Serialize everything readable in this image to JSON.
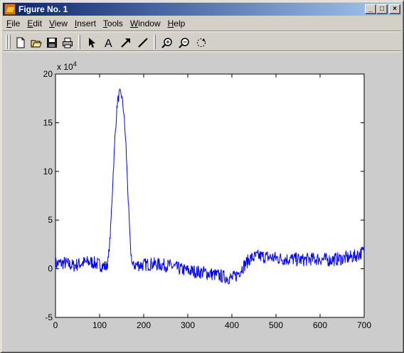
{
  "window": {
    "title": "Figure No. 1",
    "controls": {
      "minimize": "_",
      "maximize": "□",
      "close": "×"
    }
  },
  "menu": {
    "items": [
      {
        "key": "F",
        "rest": "ile"
      },
      {
        "key": "E",
        "rest": "dit"
      },
      {
        "key": "V",
        "rest": "iew"
      },
      {
        "key": "I",
        "rest": "nsert"
      },
      {
        "key": "T",
        "rest": "ools"
      },
      {
        "key": "W",
        "rest": "indow"
      },
      {
        "key": "H",
        "rest": "elp"
      }
    ]
  },
  "toolbar": {
    "icons": [
      "new-file-icon",
      "open-folder-icon",
      "save-icon",
      "print-icon",
      "select-arrow-icon",
      "text-icon",
      "arrow-icon",
      "line-icon",
      "zoom-in-icon",
      "zoom-out-icon",
      "rotate-icon"
    ],
    "text_tool_glyph": "A"
  },
  "colors": {
    "titlebar_start": "#0a246a",
    "titlebar_end": "#a6caf0",
    "figure_background": "#cccccc",
    "axes_background": "#ffffff",
    "line": "#0000ff"
  },
  "chart_data": {
    "type": "line",
    "title": "",
    "xlabel": "",
    "ylabel": "",
    "y_exponent_label": "x 10",
    "y_exponent": "4",
    "xlim": [
      0,
      700
    ],
    "ylim": [
      -5,
      20
    ],
    "xticks": [
      0,
      100,
      200,
      300,
      400,
      500,
      600,
      700
    ],
    "yticks": [
      -5,
      0,
      5,
      10,
      15,
      20
    ],
    "grid": false,
    "series": [
      {
        "color": "#0000ff",
        "x": [
          0,
          20,
          40,
          60,
          80,
          100,
          115,
          120,
          125,
          130,
          135,
          140,
          145,
          150,
          155,
          160,
          165,
          170,
          175,
          180,
          200,
          220,
          240,
          260,
          280,
          300,
          320,
          340,
          360,
          380,
          400,
          410,
          420,
          440,
          460,
          480,
          500,
          520,
          540,
          560,
          580,
          600,
          620,
          640,
          660,
          680,
          700
        ],
        "y": [
          0.5,
          0.6,
          0.3,
          0.6,
          0.7,
          0.4,
          0.2,
          1.0,
          4.0,
          9.0,
          13.5,
          17.0,
          18.0,
          17.8,
          16.0,
          12.5,
          7.0,
          2.0,
          0.3,
          0.4,
          0.4,
          0.5,
          0.4,
          0.3,
          0.0,
          -0.2,
          -0.3,
          -0.4,
          -0.6,
          -0.8,
          -1.0,
          -0.7,
          -0.1,
          1.0,
          1.3,
          1.2,
          1.1,
          1.0,
          1.0,
          0.9,
          1.0,
          1.0,
          0.9,
          1.0,
          1.1,
          1.3,
          1.8
        ]
      }
    ]
  }
}
